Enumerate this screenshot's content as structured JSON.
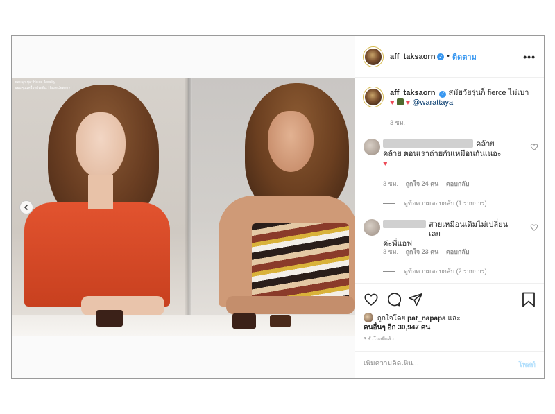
{
  "post": {
    "username": "aff_taksaorn",
    "follow_label": "ติดตาม",
    "more_label": "•••",
    "caption": {
      "username": "aff_taksaorn",
      "text": "สมัยวัยรุ่นก็ fierce ไม่เบา",
      "mention": "@warattaya",
      "time": "3 ชม."
    },
    "photo_credits": [
      "ขอบคุณชุด: Haute Jewelry",
      "ขอบคุณเครื่องประดับ: Haute Jewelry"
    ]
  },
  "comments": [
    {
      "text_line1": "คล้าย",
      "text_line2": "คล้าย ตอนเราถ่ายกันเหมือนกันเนอะ",
      "time": "3 ชม.",
      "likes": "ถูกใจ 24 คน",
      "reply_label": "ตอบกลับ",
      "view_replies": "ดูข้อความตอบกลับ (1 รายการ)"
    },
    {
      "text_line1": "สวยเหมือนเดิมไม่เปลี่ยนเลย",
      "text_line2": "ค่ะพี่แอฟ",
      "time": "3 ชม.",
      "likes": "ถูกใจ 23 คน",
      "reply_label": "ตอบกลับ",
      "view_replies": "ดูข้อความตอบกลับ (2 รายการ)"
    }
  ],
  "likes": {
    "prefix": "ถูกใจโดย",
    "user": "pat_napapa",
    "and": "และ",
    "others": "คนอื่นๆ อีก 30,947 คน"
  },
  "posted_ago": "3 ชั่วโมงที่แล้ว",
  "add_comment": {
    "placeholder": "เพิ่มความคิดเห็น...",
    "post_label": "โพสต์"
  },
  "icons": {
    "like": "heart-icon",
    "comment": "comment-icon",
    "share": "share-icon",
    "save": "bookmark-icon",
    "prev": "chevron-left-icon",
    "verified": "verified-badge-icon"
  },
  "colors": {
    "link_blue": "#3897f0",
    "heart_red": "#ed4956",
    "muted": "#8e8e8e",
    "post_disabled": "#b2dffc"
  }
}
